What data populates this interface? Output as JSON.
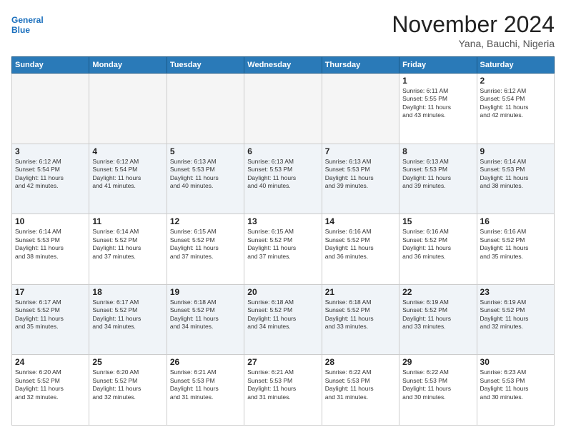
{
  "header": {
    "logo_line1": "General",
    "logo_line2": "Blue",
    "month_title": "November 2024",
    "location": "Yana, Bauchi, Nigeria"
  },
  "days_of_week": [
    "Sunday",
    "Monday",
    "Tuesday",
    "Wednesday",
    "Thursday",
    "Friday",
    "Saturday"
  ],
  "weeks": [
    [
      {
        "day": "",
        "info": ""
      },
      {
        "day": "",
        "info": ""
      },
      {
        "day": "",
        "info": ""
      },
      {
        "day": "",
        "info": ""
      },
      {
        "day": "",
        "info": ""
      },
      {
        "day": "1",
        "info": "Sunrise: 6:11 AM\nSunset: 5:55 PM\nDaylight: 11 hours\nand 43 minutes."
      },
      {
        "day": "2",
        "info": "Sunrise: 6:12 AM\nSunset: 5:54 PM\nDaylight: 11 hours\nand 42 minutes."
      }
    ],
    [
      {
        "day": "3",
        "info": "Sunrise: 6:12 AM\nSunset: 5:54 PM\nDaylight: 11 hours\nand 42 minutes."
      },
      {
        "day": "4",
        "info": "Sunrise: 6:12 AM\nSunset: 5:54 PM\nDaylight: 11 hours\nand 41 minutes."
      },
      {
        "day": "5",
        "info": "Sunrise: 6:13 AM\nSunset: 5:53 PM\nDaylight: 11 hours\nand 40 minutes."
      },
      {
        "day": "6",
        "info": "Sunrise: 6:13 AM\nSunset: 5:53 PM\nDaylight: 11 hours\nand 40 minutes."
      },
      {
        "day": "7",
        "info": "Sunrise: 6:13 AM\nSunset: 5:53 PM\nDaylight: 11 hours\nand 39 minutes."
      },
      {
        "day": "8",
        "info": "Sunrise: 6:13 AM\nSunset: 5:53 PM\nDaylight: 11 hours\nand 39 minutes."
      },
      {
        "day": "9",
        "info": "Sunrise: 6:14 AM\nSunset: 5:53 PM\nDaylight: 11 hours\nand 38 minutes."
      }
    ],
    [
      {
        "day": "10",
        "info": "Sunrise: 6:14 AM\nSunset: 5:53 PM\nDaylight: 11 hours\nand 38 minutes."
      },
      {
        "day": "11",
        "info": "Sunrise: 6:14 AM\nSunset: 5:52 PM\nDaylight: 11 hours\nand 37 minutes."
      },
      {
        "day": "12",
        "info": "Sunrise: 6:15 AM\nSunset: 5:52 PM\nDaylight: 11 hours\nand 37 minutes."
      },
      {
        "day": "13",
        "info": "Sunrise: 6:15 AM\nSunset: 5:52 PM\nDaylight: 11 hours\nand 37 minutes."
      },
      {
        "day": "14",
        "info": "Sunrise: 6:16 AM\nSunset: 5:52 PM\nDaylight: 11 hours\nand 36 minutes."
      },
      {
        "day": "15",
        "info": "Sunrise: 6:16 AM\nSunset: 5:52 PM\nDaylight: 11 hours\nand 36 minutes."
      },
      {
        "day": "16",
        "info": "Sunrise: 6:16 AM\nSunset: 5:52 PM\nDaylight: 11 hours\nand 35 minutes."
      }
    ],
    [
      {
        "day": "17",
        "info": "Sunrise: 6:17 AM\nSunset: 5:52 PM\nDaylight: 11 hours\nand 35 minutes."
      },
      {
        "day": "18",
        "info": "Sunrise: 6:17 AM\nSunset: 5:52 PM\nDaylight: 11 hours\nand 34 minutes."
      },
      {
        "day": "19",
        "info": "Sunrise: 6:18 AM\nSunset: 5:52 PM\nDaylight: 11 hours\nand 34 minutes."
      },
      {
        "day": "20",
        "info": "Sunrise: 6:18 AM\nSunset: 5:52 PM\nDaylight: 11 hours\nand 34 minutes."
      },
      {
        "day": "21",
        "info": "Sunrise: 6:18 AM\nSunset: 5:52 PM\nDaylight: 11 hours\nand 33 minutes."
      },
      {
        "day": "22",
        "info": "Sunrise: 6:19 AM\nSunset: 5:52 PM\nDaylight: 11 hours\nand 33 minutes."
      },
      {
        "day": "23",
        "info": "Sunrise: 6:19 AM\nSunset: 5:52 PM\nDaylight: 11 hours\nand 32 minutes."
      }
    ],
    [
      {
        "day": "24",
        "info": "Sunrise: 6:20 AM\nSunset: 5:52 PM\nDaylight: 11 hours\nand 32 minutes."
      },
      {
        "day": "25",
        "info": "Sunrise: 6:20 AM\nSunset: 5:52 PM\nDaylight: 11 hours\nand 32 minutes."
      },
      {
        "day": "26",
        "info": "Sunrise: 6:21 AM\nSunset: 5:53 PM\nDaylight: 11 hours\nand 31 minutes."
      },
      {
        "day": "27",
        "info": "Sunrise: 6:21 AM\nSunset: 5:53 PM\nDaylight: 11 hours\nand 31 minutes."
      },
      {
        "day": "28",
        "info": "Sunrise: 6:22 AM\nSunset: 5:53 PM\nDaylight: 11 hours\nand 31 minutes."
      },
      {
        "day": "29",
        "info": "Sunrise: 6:22 AM\nSunset: 5:53 PM\nDaylight: 11 hours\nand 30 minutes."
      },
      {
        "day": "30",
        "info": "Sunrise: 6:23 AM\nSunset: 5:53 PM\nDaylight: 11 hours\nand 30 minutes."
      }
    ]
  ]
}
